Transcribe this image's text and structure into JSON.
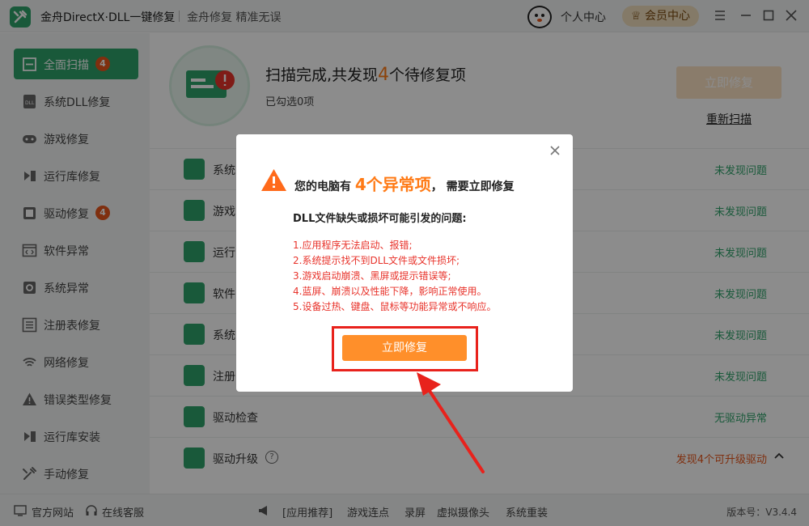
{
  "titlebar": {
    "app_title": "金舟DirectX·DLL一键修复",
    "slogan": "金舟修复 精准无误",
    "user_center": "个人中心",
    "vip_center": "会员中心"
  },
  "sidebar": {
    "items": [
      {
        "label": "全面扫描",
        "badge": "4",
        "icon": "scan-icon",
        "active": true
      },
      {
        "label": "系统DLL修复",
        "icon": "dll-icon"
      },
      {
        "label": "游戏修复",
        "icon": "gamepad-icon"
      },
      {
        "label": "运行库修复",
        "icon": "runtime-icon"
      },
      {
        "label": "驱动修复",
        "badge": "4",
        "icon": "driver-icon"
      },
      {
        "label": "软件异常",
        "icon": "code-window-icon"
      },
      {
        "label": "系统异常",
        "icon": "gear-icon"
      },
      {
        "label": "注册表修复",
        "icon": "list-icon"
      },
      {
        "label": "网络修复",
        "icon": "wifi-icon"
      },
      {
        "label": "错误类型修复",
        "icon": "warning-icon"
      },
      {
        "label": "运行库安装",
        "icon": "install-icon"
      },
      {
        "label": "手动修复",
        "icon": "wrench-icon"
      }
    ]
  },
  "main": {
    "scan_title_prefix": "扫描完成,共发现",
    "scan_count": "4",
    "scan_title_suffix": "个待修复项",
    "checked_text": "已勾选0项",
    "fix_button": "立即修复",
    "rescan": "重新扫描",
    "categories": [
      {
        "label": "系统",
        "status": "未发现问题",
        "icon": "dll-icon"
      },
      {
        "label": "游戏",
        "status": "未发现问题",
        "icon": "gamepad-icon"
      },
      {
        "label": "运行",
        "status": "未发现问题",
        "icon": "runtime-icon"
      },
      {
        "label": "软件",
        "status": "未发现问题",
        "icon": "code-window-icon"
      },
      {
        "label": "系统",
        "status": "未发现问题",
        "icon": "gear-icon"
      },
      {
        "label": "注册",
        "status": "未发现问题",
        "icon": "list-icon"
      },
      {
        "label": "驱动检查",
        "status": "无驱动异常",
        "icon": "driver-check-icon"
      },
      {
        "label": "驱动升级",
        "status": "发现4个可升级驱动",
        "icon": "driver-upgrade-icon"
      }
    ]
  },
  "modal": {
    "head_prefix": "您的电脑有",
    "head_count": "4个异常项",
    "head_suffix": "，   需要立即修复",
    "sub": "DLL文件缺失或损坏可能引发的问题:",
    "issues": [
      "1.应用程序无法启动、报错;",
      "2.系统提示找不到DLL文件或文件损坏;",
      "3.游戏启动崩溃、黑屏或提示错误等;",
      "4.蓝屏、崩溃以及性能下降，影响正常使用。",
      "5.设备过热、键盘、鼠标等功能异常或不响应。"
    ],
    "fix_button": "立即修复"
  },
  "footer": {
    "official_site": "官方网站",
    "online_service": "在线客服",
    "app_recommend": "[应用推荐]",
    "links": [
      "游戏连点",
      "录屏",
      "虚拟摄像头",
      "系统重装"
    ],
    "version": "版本号：V3.4.4"
  },
  "colors": {
    "brand_green": "#2ea36a",
    "accent_orange": "#ff8f2a",
    "alert_red": "#e8332b",
    "highlight_frame": "#e8221c"
  }
}
